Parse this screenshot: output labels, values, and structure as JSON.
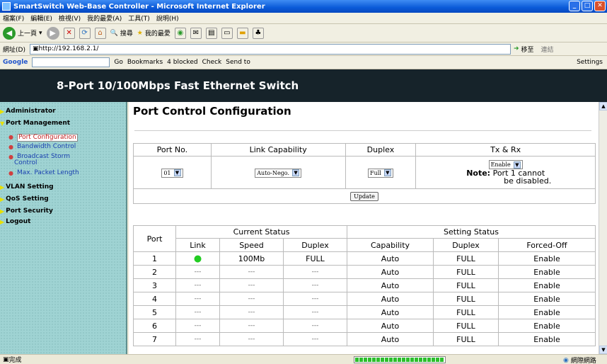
{
  "window": {
    "title": "SmartSwitch Web-Base Controller - Microsoft Internet Explorer",
    "minimize": "_",
    "maximize": "□",
    "close": "✕"
  },
  "menu": [
    "檔案(F)",
    "編輯(E)",
    "檢視(V)",
    "我的最愛(A)",
    "工具(T)",
    "說明(H)"
  ],
  "toolbar": {
    "back_label": "上一頁",
    "search_label": "搜尋",
    "favorites_label": "我的最愛"
  },
  "address": {
    "label": "網址(D)",
    "url": "http://192.168.2.1/",
    "go_label": "移至",
    "links_label": "連結"
  },
  "googlebar": {
    "logo": "Google",
    "go_label": "Go",
    "bookmarks": "Bookmarks",
    "blocked": "4 blocked",
    "check": "Check",
    "send_to": "Send to",
    "settings": "Settings"
  },
  "header": {
    "title": "8-Port 10/100Mbps Fast Ethernet Switch"
  },
  "sidebar": {
    "administrator": "Administrator",
    "port_management": "Port Management",
    "sub": [
      "Port Configuration",
      "Bandwidth Control",
      "Broadcast Storm",
      "Control",
      "Max. Packet Length"
    ],
    "vlan": "VLAN Setting",
    "qos": "QoS Setting",
    "security": "Port Security",
    "logout": "Logout"
  },
  "main": {
    "title": "Port Control Configuration",
    "config": {
      "headers": [
        "Port No.",
        "Link Capability",
        "Duplex",
        "Tx & Rx"
      ],
      "port_value": "01",
      "link_value": "Auto-Nego.",
      "duplex_value": "Full",
      "txrx_value": "Enable",
      "note_label": "Note:",
      "note_text1": "Port 1 cannot",
      "note_text2": "be disabled.",
      "update_label": "Update"
    },
    "status": {
      "port_header": "Port",
      "current_header": "Current Status",
      "setting_header": "Setting Status",
      "sub_headers": [
        "Link",
        "Speed",
        "Duplex",
        "Capability",
        "Duplex",
        "Forced-Off"
      ],
      "rows": [
        {
          "port": "1",
          "link": "●",
          "speed": "100Mb",
          "duplex": "FULL",
          "capability": "Auto",
          "set_duplex": "FULL",
          "forced": "Enable"
        },
        {
          "port": "2",
          "link": "---",
          "speed": "---",
          "duplex": "---",
          "capability": "Auto",
          "set_duplex": "FULL",
          "forced": "Enable"
        },
        {
          "port": "3",
          "link": "---",
          "speed": "---",
          "duplex": "---",
          "capability": "Auto",
          "set_duplex": "FULL",
          "forced": "Enable"
        },
        {
          "port": "4",
          "link": "---",
          "speed": "---",
          "duplex": "---",
          "capability": "Auto",
          "set_duplex": "FULL",
          "forced": "Enable"
        },
        {
          "port": "5",
          "link": "---",
          "speed": "---",
          "duplex": "---",
          "capability": "Auto",
          "set_duplex": "FULL",
          "forced": "Enable"
        },
        {
          "port": "6",
          "link": "---",
          "speed": "---",
          "duplex": "---",
          "capability": "Auto",
          "set_duplex": "FULL",
          "forced": "Enable"
        },
        {
          "port": "7",
          "link": "---",
          "speed": "---",
          "duplex": "---",
          "capability": "Auto",
          "set_duplex": "FULL",
          "forced": "Enable"
        }
      ]
    }
  },
  "status": {
    "text": "完成",
    "zone": "網際網路"
  },
  "colors": {
    "link_up": "#22cc22",
    "header_band": "#16232a",
    "sidebar": "#9fd3d3"
  }
}
